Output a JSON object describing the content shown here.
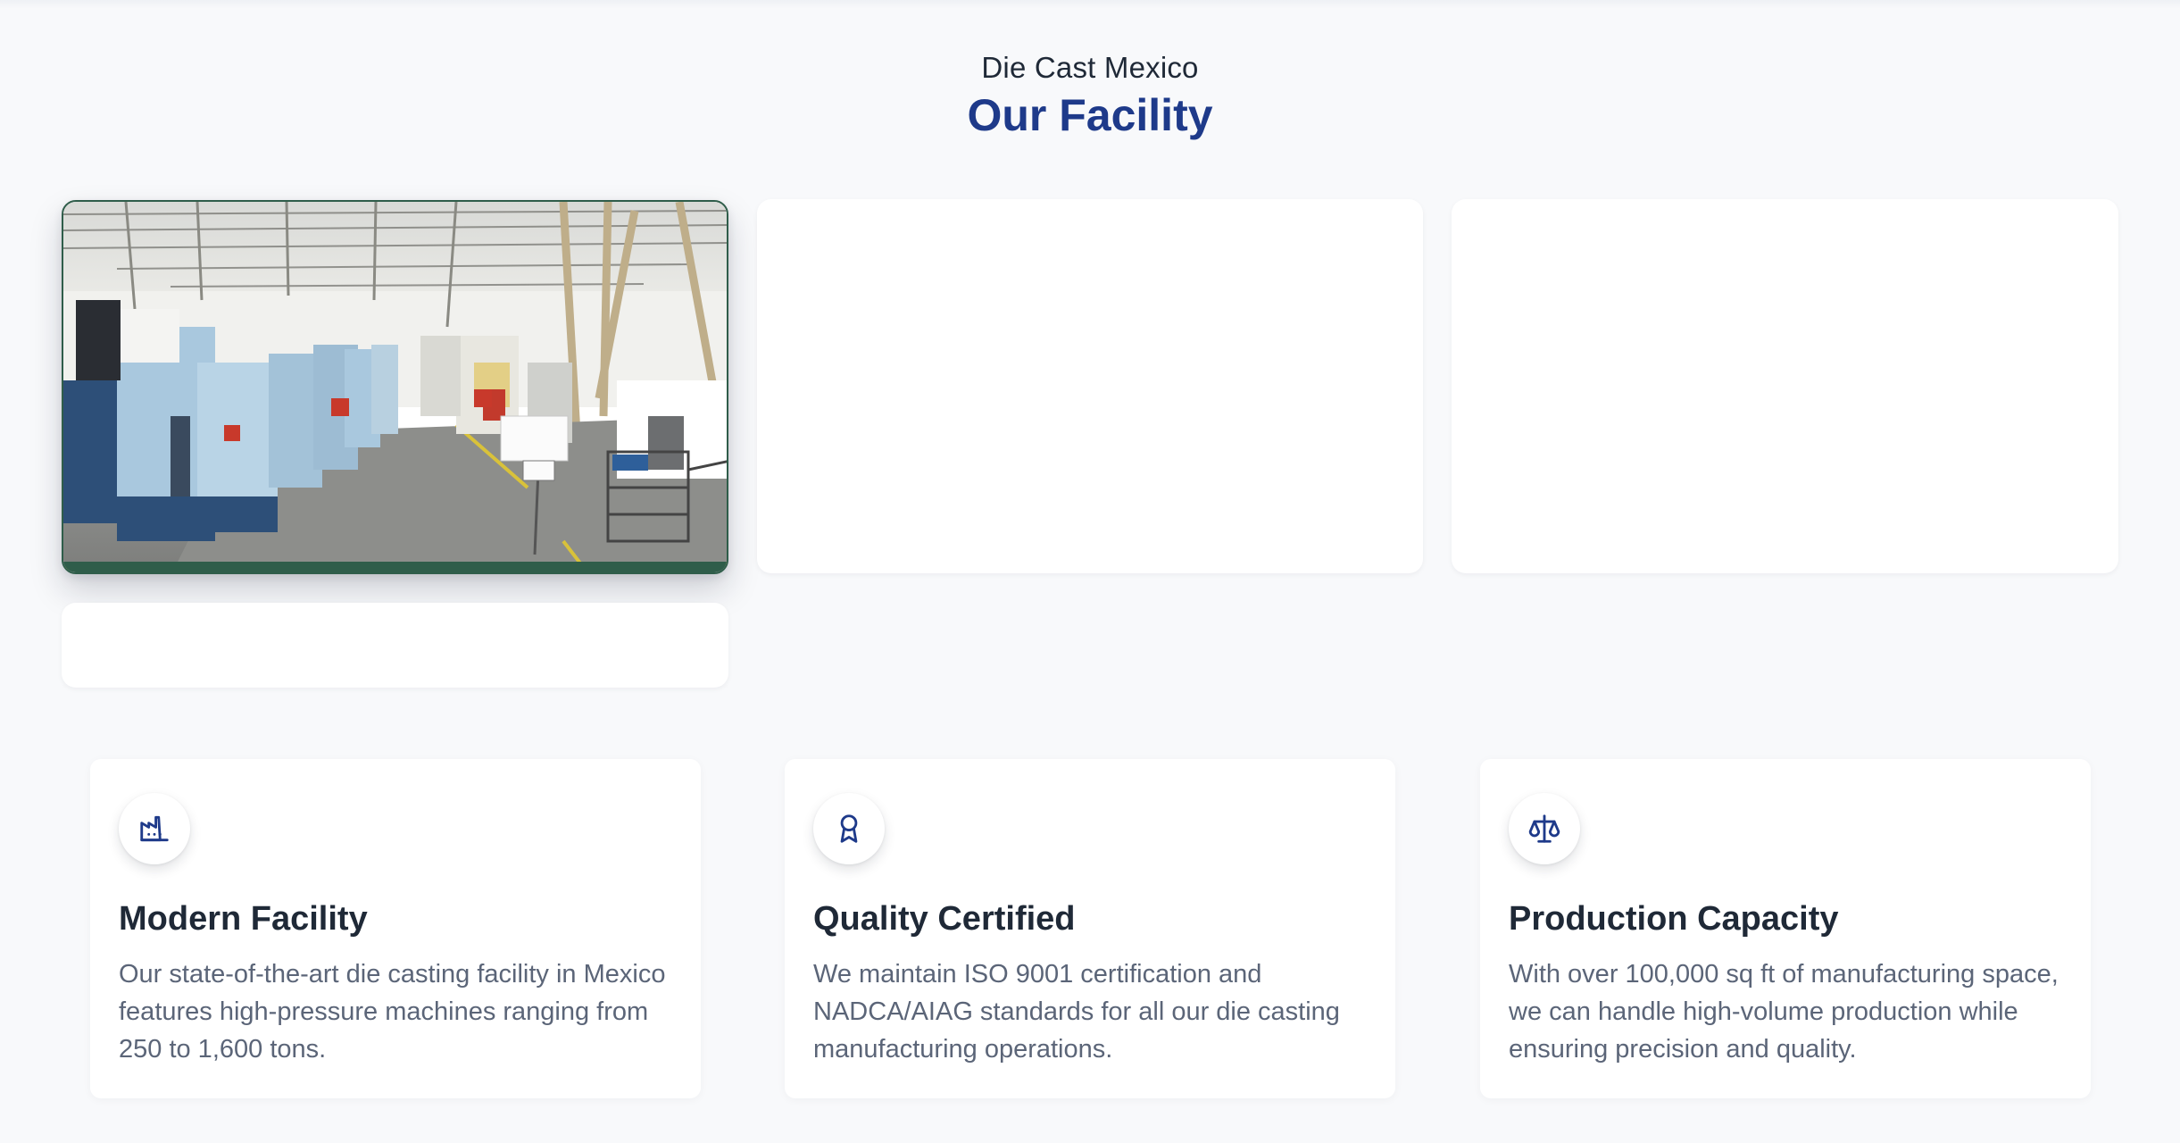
{
  "header": {
    "eyebrow": "Die Cast Mexico",
    "title": "Our Facility"
  },
  "gallery": {
    "photo_subject": "factory-floor-photo"
  },
  "features": [
    {
      "icon": "factory-icon",
      "title": "Modern Facility",
      "body": "Our state-of-the-art die casting facility in Mexico features high-pressure machines ranging from 250 to 1,600 tons."
    },
    {
      "icon": "award-icon",
      "title": "Quality Certified",
      "body": "We maintain ISO 9001 certification and NADCA/AIAG standards for all our die casting manufacturing operations."
    },
    {
      "icon": "scale-icon",
      "title": "Production Capacity",
      "body": "With over 100,000 sq ft of manufacturing space, we can handle high-volume production while ensuring precision and quality."
    }
  ],
  "colors": {
    "accent": "#1e3a8a",
    "background": "#f8f9fb",
    "card": "#ffffff",
    "body_text": "#5b6578"
  }
}
